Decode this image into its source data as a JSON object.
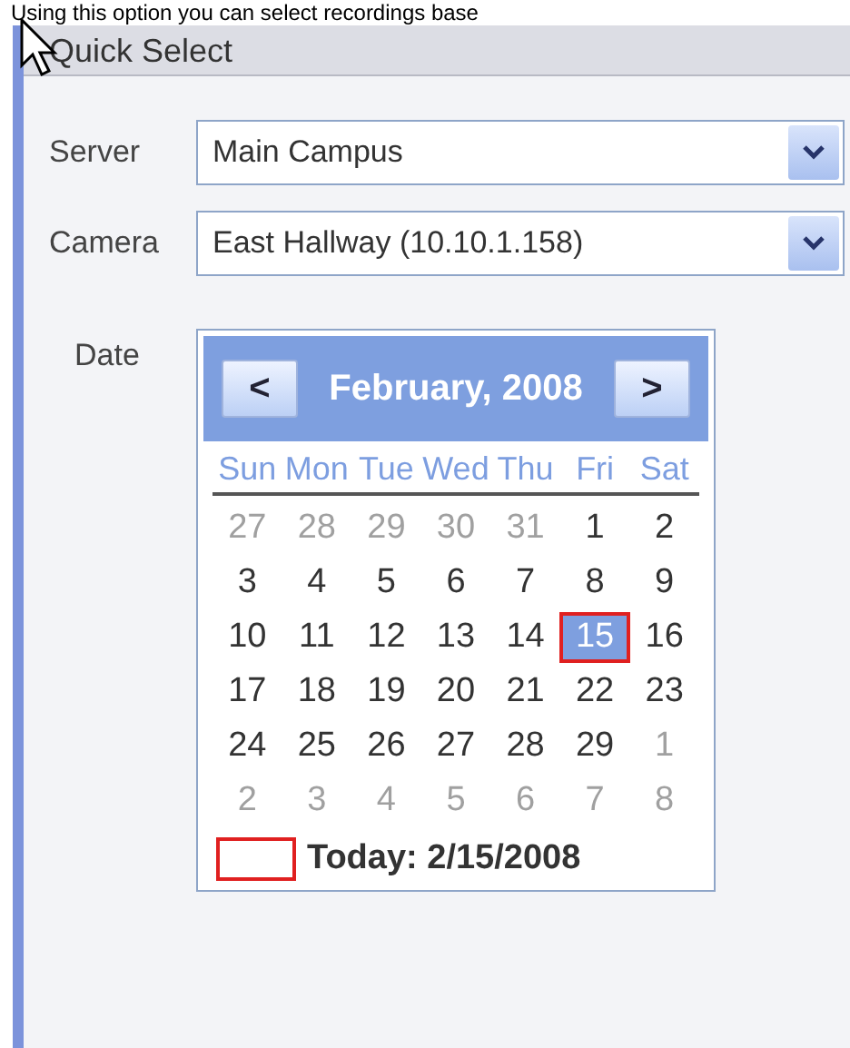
{
  "caption": "Using this option you can select recordings base",
  "panel": {
    "title": "Quick Select"
  },
  "fields": [
    {
      "label": "Server",
      "value": "Main Campus"
    },
    {
      "label": "Camera",
      "value": "East Hallway (10.10.1.158)"
    }
  ],
  "date_label": "Date",
  "calendar": {
    "prev": "<",
    "next": ">",
    "month": "February, 2008",
    "weekdays": [
      "Sun",
      "Mon",
      "Tue",
      "Wed",
      "Thu",
      "Fri",
      "Sat"
    ],
    "weeks": [
      [
        {
          "day": "27",
          "in_month": false,
          "selected": false
        },
        {
          "day": "28",
          "in_month": false,
          "selected": false
        },
        {
          "day": "29",
          "in_month": false,
          "selected": false
        },
        {
          "day": "30",
          "in_month": false,
          "selected": false
        },
        {
          "day": "31",
          "in_month": false,
          "selected": false
        },
        {
          "day": "1",
          "in_month": true,
          "selected": false
        },
        {
          "day": "2",
          "in_month": true,
          "selected": false
        }
      ],
      [
        {
          "day": "3",
          "in_month": true,
          "selected": false
        },
        {
          "day": "4",
          "in_month": true,
          "selected": false
        },
        {
          "day": "5",
          "in_month": true,
          "selected": false
        },
        {
          "day": "6",
          "in_month": true,
          "selected": false
        },
        {
          "day": "7",
          "in_month": true,
          "selected": false
        },
        {
          "day": "8",
          "in_month": true,
          "selected": false
        },
        {
          "day": "9",
          "in_month": true,
          "selected": false
        }
      ],
      [
        {
          "day": "10",
          "in_month": true,
          "selected": false
        },
        {
          "day": "11",
          "in_month": true,
          "selected": false
        },
        {
          "day": "12",
          "in_month": true,
          "selected": false
        },
        {
          "day": "13",
          "in_month": true,
          "selected": false
        },
        {
          "day": "14",
          "in_month": true,
          "selected": false
        },
        {
          "day": "15",
          "in_month": true,
          "selected": true
        },
        {
          "day": "16",
          "in_month": true,
          "selected": false
        }
      ],
      [
        {
          "day": "17",
          "in_month": true,
          "selected": false
        },
        {
          "day": "18",
          "in_month": true,
          "selected": false
        },
        {
          "day": "19",
          "in_month": true,
          "selected": false
        },
        {
          "day": "20",
          "in_month": true,
          "selected": false
        },
        {
          "day": "21",
          "in_month": true,
          "selected": false
        },
        {
          "day": "22",
          "in_month": true,
          "selected": false
        },
        {
          "day": "23",
          "in_month": true,
          "selected": false
        }
      ],
      [
        {
          "day": "24",
          "in_month": true,
          "selected": false
        },
        {
          "day": "25",
          "in_month": true,
          "selected": false
        },
        {
          "day": "26",
          "in_month": true,
          "selected": false
        },
        {
          "day": "27",
          "in_month": true,
          "selected": false
        },
        {
          "day": "28",
          "in_month": true,
          "selected": false
        },
        {
          "day": "29",
          "in_month": true,
          "selected": false
        },
        {
          "day": "1",
          "in_month": false,
          "selected": false
        }
      ],
      [
        {
          "day": "2",
          "in_month": false,
          "selected": false
        },
        {
          "day": "3",
          "in_month": false,
          "selected": false
        },
        {
          "day": "4",
          "in_month": false,
          "selected": false
        },
        {
          "day": "5",
          "in_month": false,
          "selected": false
        },
        {
          "day": "6",
          "in_month": false,
          "selected": false
        },
        {
          "day": "7",
          "in_month": false,
          "selected": false
        },
        {
          "day": "8",
          "in_month": false,
          "selected": false
        }
      ]
    ],
    "today": "Today: 2/15/2008"
  }
}
